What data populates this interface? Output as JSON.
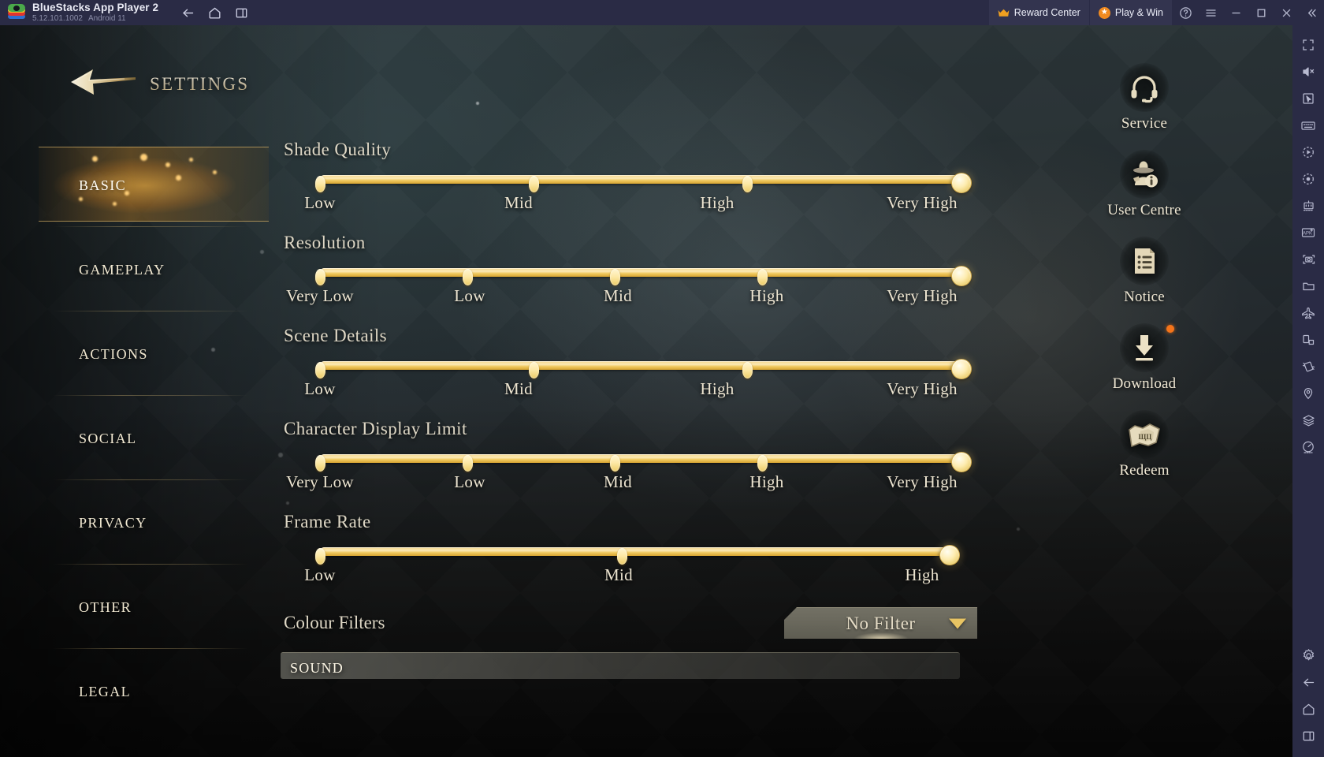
{
  "titlebar": {
    "app_title": "BlueStacks App Player 2",
    "version": "5.12.101.1002",
    "android": "Android 11",
    "nav": [
      {
        "name": "back-icon",
        "label": "Back"
      },
      {
        "name": "home-icon",
        "label": "Home"
      },
      {
        "name": "multi-instance-icon",
        "label": "Multi-instance"
      }
    ],
    "reward_center": "Reward Center",
    "play_and_win": "Play & Win",
    "help_label": "Help",
    "menu_label": "Menu",
    "minimize_label": "Minimize",
    "maximize_label": "Maximize",
    "close_label": "Close",
    "collapse_label": "Collapse"
  },
  "rail": {
    "items": [
      {
        "name": "fullscreen-icon",
        "label": "Full screen"
      },
      {
        "name": "mute-icon",
        "label": "Mute"
      },
      {
        "name": "cursor-icon",
        "label": "Pointer"
      },
      {
        "name": "keyboard-controls-icon",
        "label": "Game controls"
      },
      {
        "name": "macro-play-icon",
        "label": "Macro recorder"
      },
      {
        "name": "record-icon",
        "label": "Record screen"
      },
      {
        "name": "eco-mode-icon",
        "label": "Eco mode"
      },
      {
        "name": "install-apk-icon",
        "label": "Install APK"
      },
      {
        "name": "screenshot-icon",
        "label": "Screenshot"
      },
      {
        "name": "media-manager-icon",
        "label": "Media manager"
      },
      {
        "name": "airplane-icon",
        "label": "Airplane mode"
      },
      {
        "name": "rotate-icon",
        "label": "Rotate"
      },
      {
        "name": "shake-icon",
        "label": "Shake"
      },
      {
        "name": "location-icon",
        "label": "Location"
      },
      {
        "name": "layers-icon",
        "label": "Multi-instance sync"
      },
      {
        "name": "performance-icon",
        "label": "Performance"
      },
      {
        "name": "settings-icon",
        "label": "Settings"
      },
      {
        "name": "back-icon",
        "label": "Back"
      },
      {
        "name": "home-icon",
        "label": "Home"
      },
      {
        "name": "recents-icon",
        "label": "Recents"
      }
    ]
  },
  "page": {
    "title": "Settings"
  },
  "sidebar": {
    "items": [
      {
        "label": "Basic",
        "active": true
      },
      {
        "label": "Gameplay",
        "active": false
      },
      {
        "label": "Actions",
        "active": false
      },
      {
        "label": "Social",
        "active": false
      },
      {
        "label": "Privacy",
        "active": false
      },
      {
        "label": "Other",
        "active": false
      },
      {
        "label": "Legal",
        "active": false
      }
    ]
  },
  "settings": {
    "sliders": [
      {
        "label": "Shade Quality",
        "ticks": [
          "Low",
          "Mid",
          "High",
          "Very High"
        ],
        "value_index": 3,
        "value": "Very High"
      },
      {
        "label": "Resolution",
        "ticks": [
          "Very Low",
          "Low",
          "Mid",
          "High",
          "Very High"
        ],
        "value_index": 4,
        "value": "Very High"
      },
      {
        "label": "Scene Details",
        "ticks": [
          "Low",
          "Mid",
          "High",
          "Very High"
        ],
        "value_index": 3,
        "value": "Very High"
      },
      {
        "label": "Character Display Limit",
        "ticks": [
          "Very Low",
          "Low",
          "Mid",
          "High",
          "Very High"
        ],
        "value_index": 4,
        "value": "Very High"
      },
      {
        "label": "Frame Rate",
        "ticks": [
          "Low",
          "Mid",
          "High"
        ],
        "value_index": 2,
        "value": "High"
      }
    ],
    "colour_filters": {
      "label": "Colour Filters",
      "value": "No Filter",
      "caret": "chevron-down-icon"
    },
    "sound_section": "Sound"
  },
  "side_icons": [
    {
      "label": "Service",
      "icon": "headset-icon",
      "badge": false
    },
    {
      "label": "User Centre",
      "icon": "user-info-icon",
      "badge": false
    },
    {
      "label": "Notice",
      "icon": "notice-icon",
      "badge": false
    },
    {
      "label": "Download",
      "icon": "download-icon",
      "badge": true
    },
    {
      "label": "Redeem",
      "icon": "ticket-icon",
      "badge": false
    }
  ],
  "colors": {
    "gold": "#f0c95f",
    "gold_light": "#fff6d2",
    "parchment": "#efe7d3",
    "bluestacks_chrome": "#2a2b45",
    "accent_orange": "#f4741a"
  }
}
